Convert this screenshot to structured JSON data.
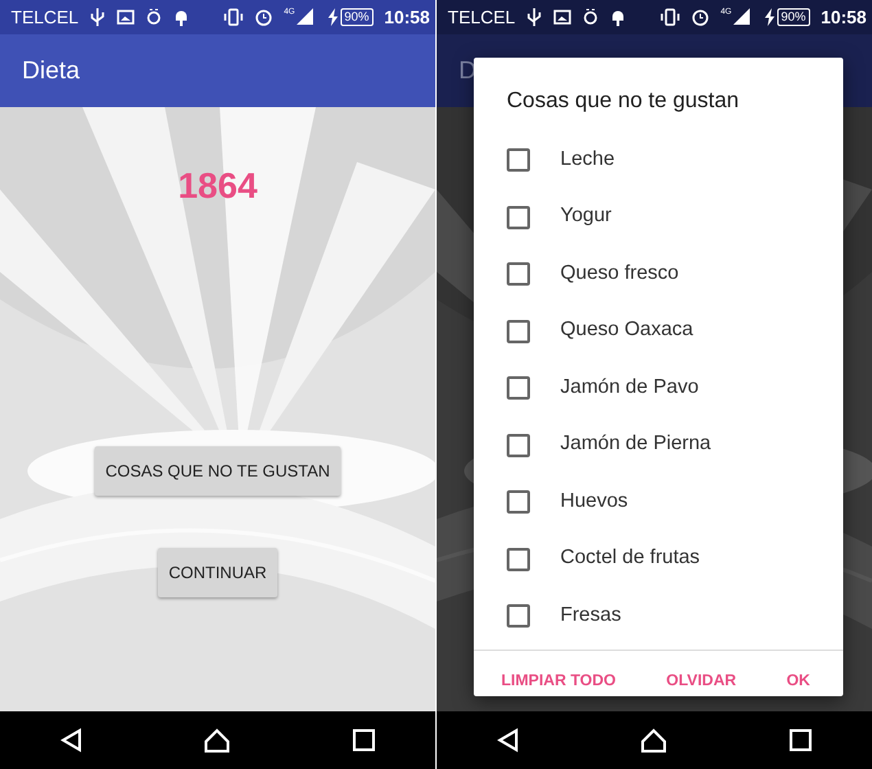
{
  "screens": [
    {
      "status_bar": {
        "carrier": "TELCEL",
        "network": "4G",
        "battery": "90%",
        "time": "10:58"
      },
      "app_bar": {
        "title": "Dieta"
      },
      "dimmed": false,
      "value": "1864",
      "buttons": [
        "COSAS QUE NO TE GUSTAN",
        "CONTINUAR"
      ]
    },
    {
      "status_bar": {
        "carrier": "TELCEL",
        "network": "4G",
        "battery": "90%",
        "time": "10:58"
      },
      "app_bar": {
        "title": "D"
      },
      "dimmed": true,
      "dialog": {
        "title": "Cosas que no te gustan",
        "items": [
          {
            "label": "Leche",
            "checked": false
          },
          {
            "label": "Yogur",
            "checked": false
          },
          {
            "label": "Queso fresco",
            "checked": false
          },
          {
            "label": "Queso Oaxaca",
            "checked": false
          },
          {
            "label": "Jamón de Pavo",
            "checked": false
          },
          {
            "label": "Jamón de Pierna",
            "checked": false
          },
          {
            "label": "Huevos",
            "checked": false
          },
          {
            "label": "Coctel de frutas",
            "checked": false
          },
          {
            "label": "Fresas",
            "checked": false
          }
        ],
        "actions": [
          "LIMPIAR TODO",
          "OLVIDAR",
          "OK"
        ]
      }
    }
  ]
}
